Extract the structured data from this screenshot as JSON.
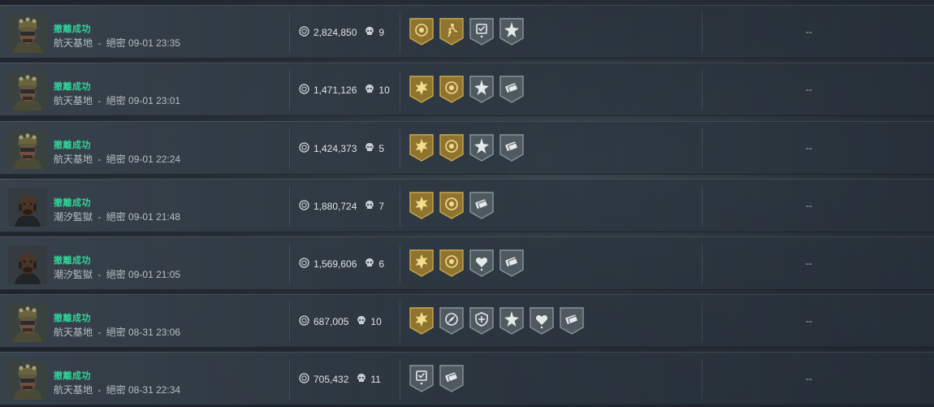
{
  "records": [
    {
      "avatar": "operator-a",
      "status": "撤離成功",
      "map": "航天基地",
      "difficulty": "絕密",
      "time": "09-01 23:35",
      "value": "2,824,850",
      "kills": "9",
      "badges": [
        "gold-target",
        "gold-runner",
        "silver-check",
        "silver-star"
      ],
      "extra": "--"
    },
    {
      "avatar": "operator-a",
      "status": "撤離成功",
      "map": "航天基地",
      "difficulty": "絕密",
      "time": "09-01 23:01",
      "value": "1,471,126",
      "kills": "10",
      "badges": [
        "gold-burst",
        "gold-target",
        "silver-star",
        "silver-cash"
      ],
      "extra": "--"
    },
    {
      "avatar": "operator-a",
      "status": "撤離成功",
      "map": "航天基地",
      "difficulty": "絕密",
      "time": "09-01 22:24",
      "value": "1,424,373",
      "kills": "5",
      "badges": [
        "gold-burst",
        "gold-target",
        "silver-star",
        "silver-cash"
      ],
      "extra": "--"
    },
    {
      "avatar": "operator-b",
      "status": "撤離成功",
      "map": "潮汐監獄",
      "difficulty": "絕密",
      "time": "09-01 21:48",
      "value": "1,880,724",
      "kills": "7",
      "badges": [
        "gold-burst",
        "gold-target",
        "silver-cash"
      ],
      "extra": "--"
    },
    {
      "avatar": "operator-b",
      "status": "撤離成功",
      "map": "潮汐監獄",
      "difficulty": "絕密",
      "time": "09-01 21:05",
      "value": "1,569,606",
      "kills": "6",
      "badges": [
        "gold-burst",
        "gold-target",
        "silver-heart",
        "silver-cash"
      ],
      "extra": "--"
    },
    {
      "avatar": "operator-a",
      "status": "撤離成功",
      "map": "航天基地",
      "difficulty": "絕密",
      "time": "08-31 23:06",
      "value": "687,005",
      "kills": "10",
      "badges": [
        "gold-burst",
        "silver-compass",
        "silver-shield",
        "silver-star",
        "silver-heart",
        "silver-cash"
      ],
      "extra": "--"
    },
    {
      "avatar": "operator-a",
      "status": "撤離成功",
      "map": "航天基地",
      "difficulty": "絕密",
      "time": "08-31 22:34",
      "value": "705,432",
      "kills": "11",
      "badges": [
        "silver-check",
        "silver-cash"
      ],
      "extra": "--"
    }
  ],
  "colors": {
    "success": "#2fd69a",
    "gold": "#9a7e34",
    "silver": "#5c666e"
  }
}
